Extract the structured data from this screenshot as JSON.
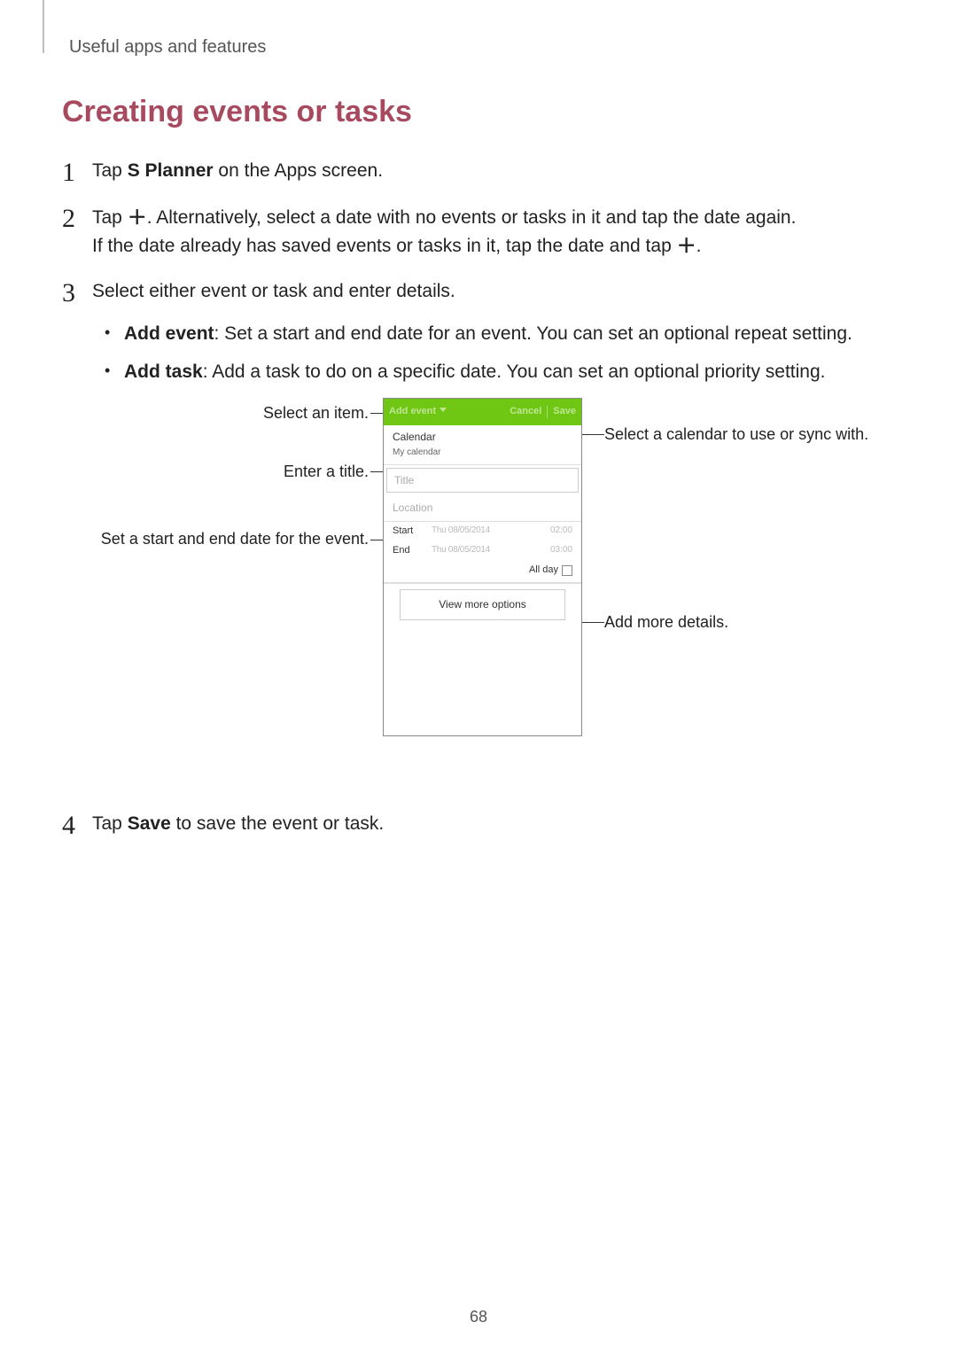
{
  "header": {
    "section_label": "Useful apps and features",
    "heading": "Creating events or tasks",
    "page_number": "68"
  },
  "steps": {
    "s1": {
      "num": "1",
      "pre": "Tap ",
      "app": "S Planner",
      "post": " on the Apps screen."
    },
    "s2": {
      "num": "2",
      "line1_pre": "Tap ",
      "line1_post": ". Alternatively, select a date with no events or tasks in it and tap the date again.",
      "line2_pre": "If the date already has saved events or tasks in it, tap the date and tap ",
      "line2_post": "."
    },
    "s3": {
      "num": "3",
      "intro": "Select either event or task and enter details.",
      "bullets": {
        "b1_bold": "Add event",
        "b1_rest": ": Set a start and end date for an event. You can set an optional repeat setting.",
        "b2_bold": "Add task",
        "b2_rest": ": Add a task to do on a specific date. You can set an optional priority setting."
      }
    },
    "s4": {
      "num": "4",
      "pre": "Tap ",
      "bold": "Save",
      "post": " to save the event or task."
    }
  },
  "callouts": {
    "select_item": "Select an item.",
    "select_calendar": "Select a calendar to use or sync with.",
    "enter_title": "Enter a title.",
    "set_dates": "Set a start and end date for the event.",
    "add_more": "Add more details."
  },
  "phone": {
    "hdr_add_event": "Add event",
    "hdr_cancel": "Cancel",
    "hdr_save": "Save",
    "calendar_label": "Calendar",
    "calendar_value": "My calendar",
    "title_placeholder": "Title",
    "location_placeholder": "Location",
    "start_label": "Start",
    "end_label": "End",
    "start_date": "Thu 08/05/2014",
    "start_time": "02:00",
    "end_date": "Thu 08/05/2014",
    "end_time": "03:00",
    "all_day": "All day",
    "view_more": "View more options"
  }
}
